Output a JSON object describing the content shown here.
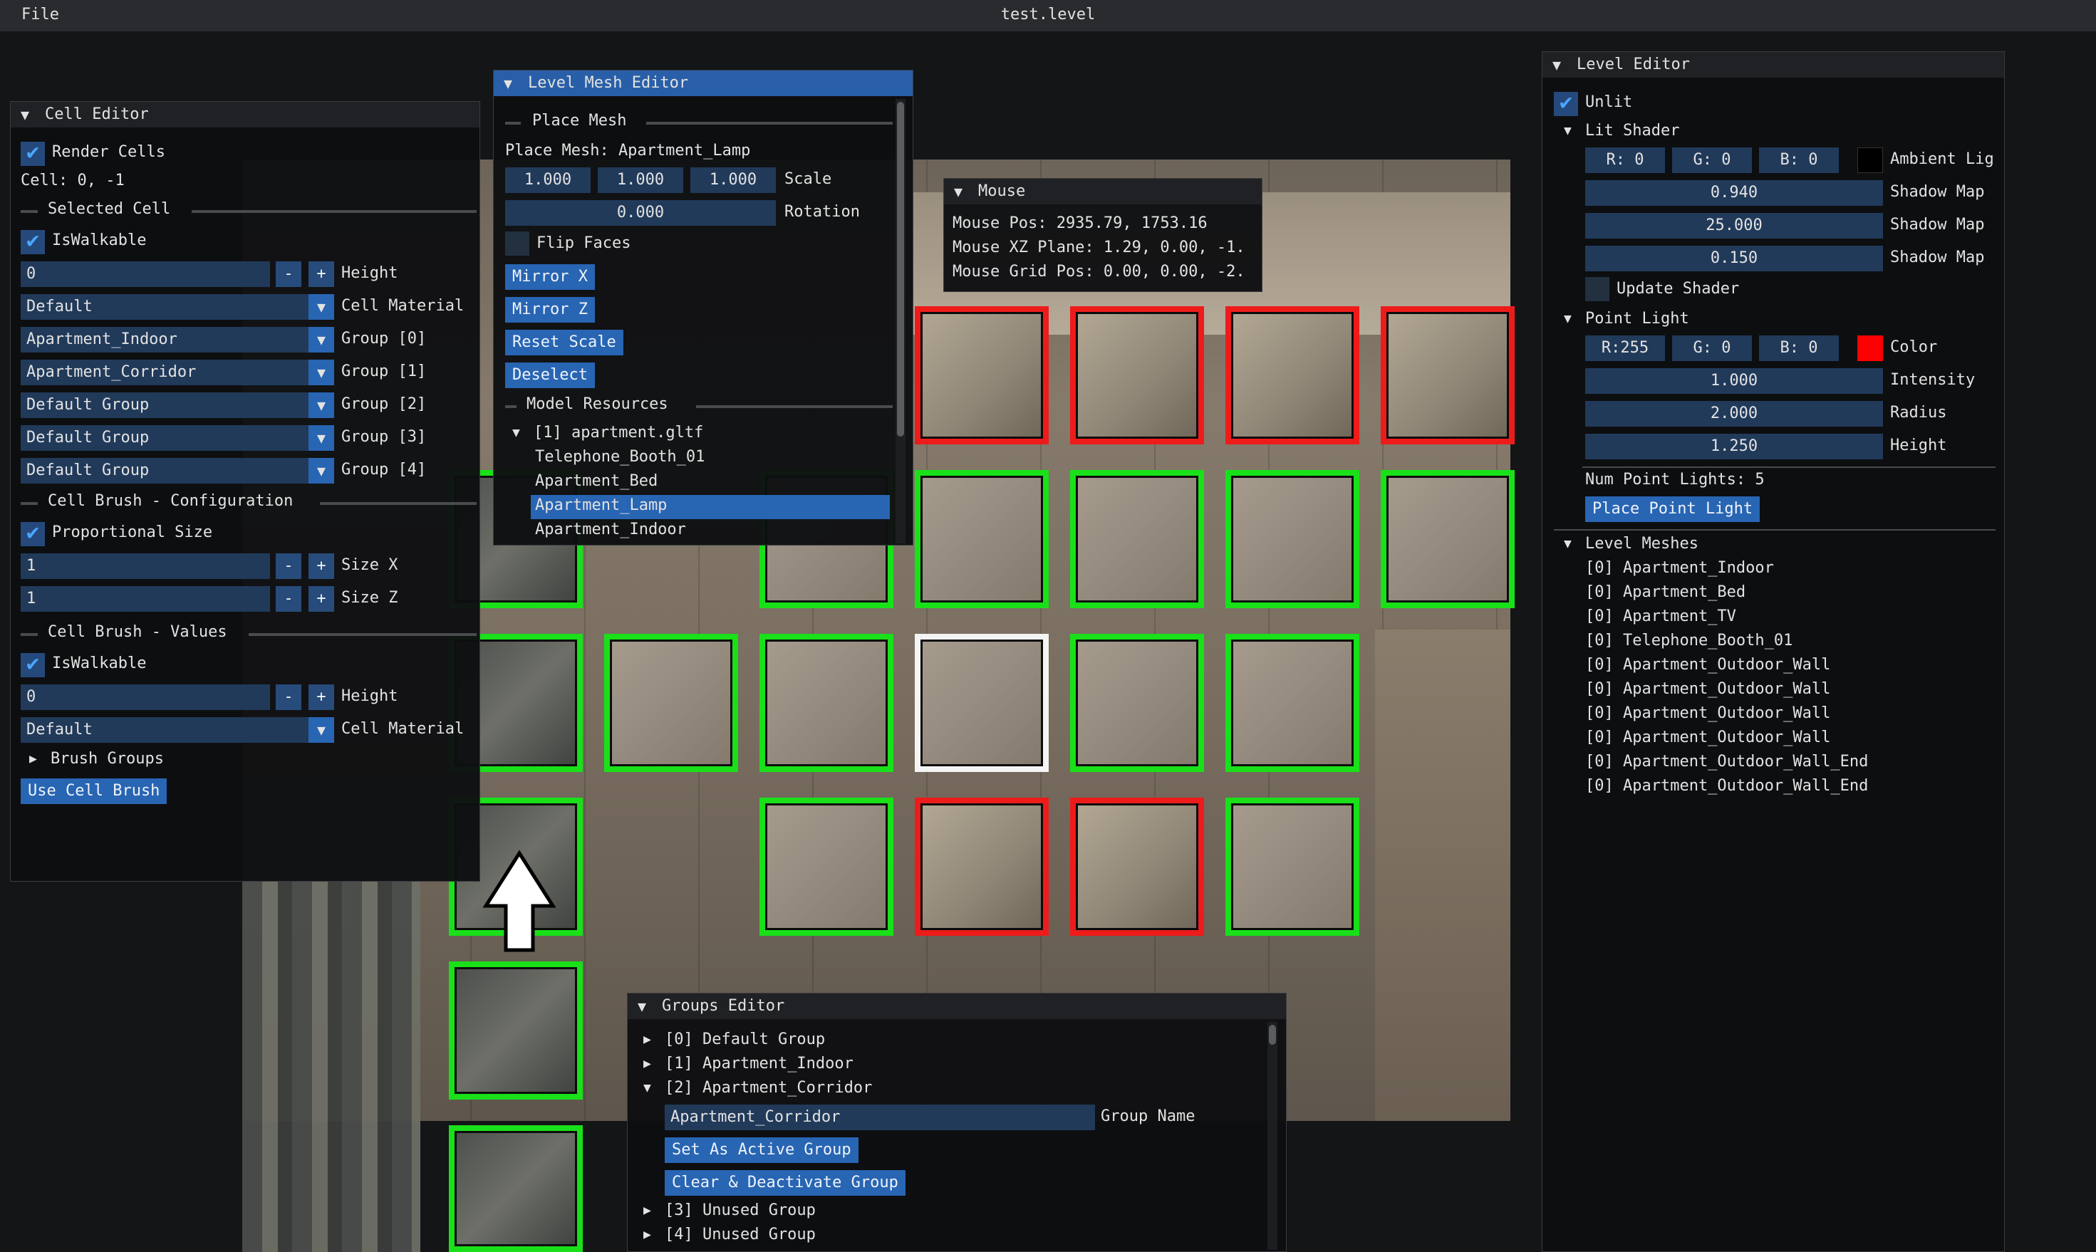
{
  "menubar": {
    "file": "File",
    "title": "test.level"
  },
  "cell_editor": {
    "title": "Cell Editor",
    "render_cells": "Render Cells",
    "cell_coords": "Cell: 0, -1",
    "selected_cell": "Selected Cell",
    "is_walkable": "IsWalkable",
    "height_value": "0",
    "height_label": "Height",
    "material_value": "Default",
    "material_label": "Cell Material",
    "groups": [
      {
        "value": "Apartment_Indoor",
        "label": "Group [0]"
      },
      {
        "value": "Apartment_Corridor",
        "label": "Group [1]"
      },
      {
        "value": "Default Group",
        "label": "Group [2]"
      },
      {
        "value": "Default Group",
        "label": "Group [3]"
      },
      {
        "value": "Default Group",
        "label": "Group [4]"
      }
    ],
    "brush_config": "Cell Brush - Configuration",
    "proportional_size": "Proportional Size",
    "size_x_value": "1",
    "size_x_label": "Size X",
    "size_z_value": "1",
    "size_z_label": "Size Z",
    "brush_values": "Cell Brush - Values",
    "brush_is_walkable": "IsWalkable",
    "brush_height_value": "0",
    "brush_height_label": "Height",
    "brush_material_value": "Default",
    "brush_material_label": "Cell Material",
    "brush_groups": "Brush Groups",
    "use_cell_brush": "Use Cell Brush",
    "minus": "-",
    "plus": "+"
  },
  "mesh_editor": {
    "title": "Level Mesh Editor",
    "place_mesh_section": "Place Mesh",
    "place_mesh_text": "Place Mesh: Apartment_Lamp",
    "scale": [
      "1.000",
      "1.000",
      "1.000"
    ],
    "scale_label": "Scale",
    "rotation": "0.000",
    "rotation_label": "Rotation",
    "flip_faces": "Flip Faces",
    "mirror_x": "Mirror X",
    "mirror_z": "Mirror Z",
    "reset_scale": "Reset Scale",
    "deselect": "Deselect",
    "model_resources": "Model Resources",
    "resource_file": "[1] apartment.gltf",
    "resources": [
      "Telephone_Booth_01",
      "Apartment_Bed",
      "Apartment_Lamp",
      "Apartment_Indoor"
    ],
    "selected_resource": "Apartment_Lamp"
  },
  "mouse": {
    "title": "Mouse",
    "pos": "Mouse Pos: 2935.79, 1753.16",
    "xz_plane": "Mouse XZ Plane: 1.29, 0.00, -1.",
    "grid_pos": "Mouse Grid Pos: 0.00, 0.00, -2."
  },
  "level_editor": {
    "title": "Level Editor",
    "unlit": "Unlit",
    "lit_shader": "Lit Shader",
    "ambient": {
      "r": "R:  0",
      "g": "G:  0",
      "b": "B:  0",
      "label": "Ambient Lig",
      "swatch": "#000000"
    },
    "shadow_rows": [
      {
        "value": "0.940",
        "label": "Shadow Map"
      },
      {
        "value": "25.000",
        "label": "Shadow Map"
      },
      {
        "value": "0.150",
        "label": "Shadow Map"
      }
    ],
    "update_shader": "Update Shader",
    "point_light": "Point Light",
    "color": {
      "r": "R:255",
      "g": "G:  0",
      "b": "B:  0",
      "label": "Color",
      "swatch": "#ff0000"
    },
    "light_rows": [
      {
        "value": "1.000",
        "label": "Intensity"
      },
      {
        "value": "2.000",
        "label": "Radius"
      },
      {
        "value": "1.250",
        "label": "Height"
      }
    ],
    "num_point_lights": "Num Point Lights: 5",
    "place_point_light": "Place Point Light",
    "level_meshes": "Level Meshes",
    "meshes": [
      "[0] Apartment_Indoor",
      "[0] Apartment_Bed",
      "[0] Apartment_TV",
      "[0] Telephone_Booth_01",
      "[0] Apartment_Outdoor_Wall",
      "[0] Apartment_Outdoor_Wall",
      "[0] Apartment_Outdoor_Wall",
      "[0] Apartment_Outdoor_Wall",
      "[0] Apartment_Outdoor_Wall_End",
      "[0] Apartment_Outdoor_Wall_End"
    ]
  },
  "groups_editor": {
    "title": "Groups Editor",
    "groups": [
      "[0] Default Group",
      "[1] Apartment_Indoor",
      "[2] Apartment_Corridor"
    ],
    "group_name_value": "Apartment_Corridor",
    "group_name_label": "Group Name",
    "set_active": "Set As Active Group",
    "clear_deactivate": "Clear & Deactivate Group",
    "unused": [
      "[3] Unused Group",
      "[4] Unused Group"
    ]
  },
  "colors": {
    "accent": "#2865b3",
    "header_active": "#295fa8",
    "cell_walkable": "#19e019",
    "cell_blocked": "#ee1b1b",
    "cell_selected": "#f4f4f4"
  },
  "icons": {
    "collapse": "triangle-down-icon",
    "expand": "triangle-right-icon",
    "check": "check-icon",
    "combo": "combo-arrow-icon",
    "cursor": "cursor-arrow-icon"
  },
  "glyphs": {
    "down": "▼",
    "right": "▶",
    "check": "✔"
  }
}
